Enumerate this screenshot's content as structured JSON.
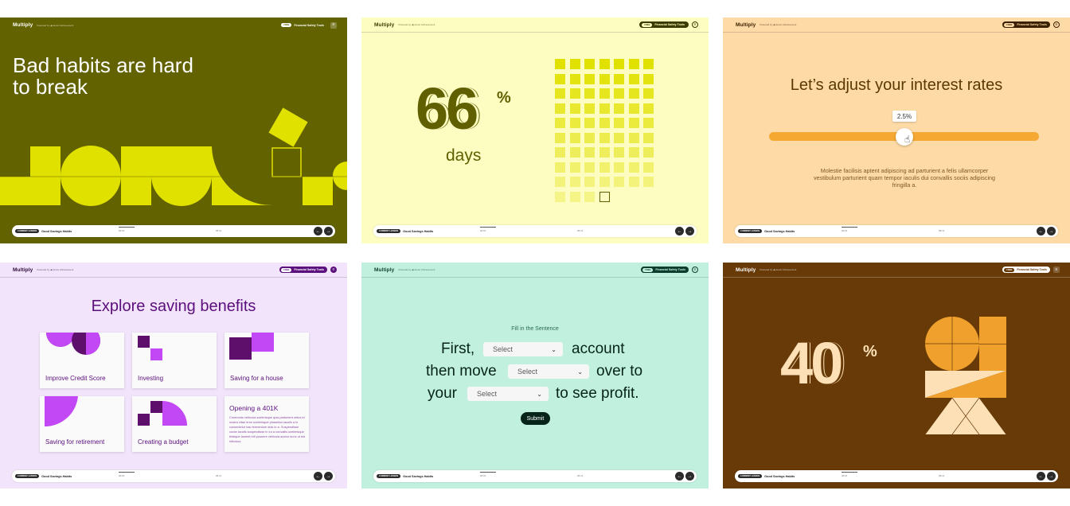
{
  "common": {
    "brand": "Multiply",
    "powered_by": "Powered by ◀ Junior Achievement",
    "tool_badge": "FREE",
    "tool_label": "Financial Safety Tools",
    "menu_glyph": "≡",
    "lesson_badge": "CURRENT LESSON",
    "lesson_name": "Good Savings Habits",
    "time_elapsed": "00:01",
    "time_total": "05:11",
    "prev_glyph": "←",
    "next_glyph": "→"
  },
  "panel1": {
    "title": "Bad habits are hard to break"
  },
  "panel2": {
    "stat": "66",
    "percent_sign": "%",
    "caption": "days",
    "filled_cells": 66,
    "outline_cells": 1
  },
  "panel3": {
    "question": "Let’s adjust your interest rates",
    "slider_value": "2.5%",
    "slider_fraction": 0.5,
    "description": "Molestie facilisis aptent adipiscing ad parturient a felis ullamcorper vestibulum parturient quam tempor iaculis dui convallis sociis adipiscing fringilla a."
  },
  "panel4": {
    "title": "Explore saving benefits",
    "cards": [
      "Improve Credit Score",
      "Investing",
      "Saving for a house",
      "Saving for retirement",
      "Creating a budget"
    ],
    "open_card": {
      "title": "Opening a 401K",
      "body": "Commodo vehicula scelerisque quis parturient netus id nostra vitae eros scelerisque phasellus iaculis a in consectetur hac fermentum duis in a. Suspendisse curae iaculis suspendisse in eu a convallis scelerisque tristique laoreet elit posuere vehicula auctor nunc ut est ridiculus."
    }
  },
  "panel5": {
    "heading": "Fill in the Sentence",
    "line1_start": "First,",
    "line1_end": "account",
    "line2_start": "then move",
    "line2_end": "over to",
    "line3_start": "your",
    "line3_end": "to see profit.",
    "select_placeholder": "Select",
    "chevron": "⌄",
    "submit_label": "Submit"
  },
  "panel6": {
    "stat": "40",
    "percent_sign": "%"
  },
  "colors": {
    "olive": "#626200",
    "lime": "#e1e100",
    "cream_yellow": "#fdfdc2",
    "peach": "#fddaa6",
    "orange": "#f5a932",
    "lavender": "#f2e5fb",
    "purple": "#5b0f7c",
    "violet": "#c247f5",
    "mint": "#c1f0de",
    "dark_green": "#07241a",
    "brown": "#673a08",
    "light_cream": "#fde0b6"
  }
}
